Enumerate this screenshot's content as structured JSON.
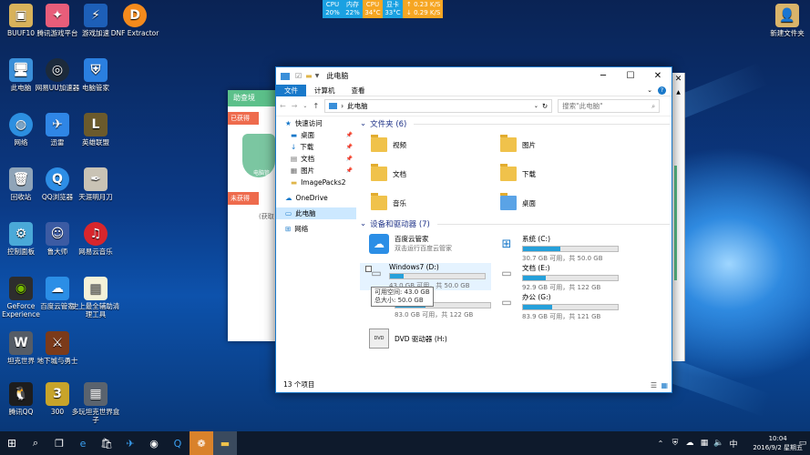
{
  "monitor": {
    "cpu_label": "CPU",
    "cpu_value": "20%",
    "mem_label": "内存",
    "mem_value": "22%",
    "cpu_temp_label": "CPU",
    "cpu_temp": "34°C",
    "gpu_label": "显卡",
    "gpu_temp": "33°C",
    "up": "0.23 K/S",
    "down": "0.29 K/S"
  },
  "desktop_left": [
    [
      "BUUF10",
      "腾讯游戏平台",
      "游戏加速",
      "DNF Extractor"
    ],
    [
      "此电脑",
      "网易UU加速器",
      "电脑管家"
    ],
    [
      "网络",
      "迅雷",
      "英雄联盟"
    ],
    [
      "回收站",
      "QQ浏览器",
      "天涯明月刀"
    ],
    [
      "控制面板",
      "鲁大师",
      "网易云音乐"
    ],
    [
      "GeForce Experience",
      "百度云管家",
      "史上最全辅助清理工具"
    ],
    [
      "坦克世界",
      "地下城与勇士"
    ],
    [
      "腾讯QQ",
      "300",
      "多玩坦克世界盒子"
    ]
  ],
  "desktop_right": "新建文件夹",
  "bgapp": {
    "title": "助查境",
    "tag1": "已获得",
    "tag2": "未获得",
    "text1": "电脑管",
    "text2": "(获取"
  },
  "explorer": {
    "title": "此电脑",
    "tabs": [
      "文件",
      "计算机",
      "查看"
    ],
    "address": "此电脑",
    "search_placeholder": "搜索\"此电脑\"",
    "nav": [
      {
        "label": "快速访问"
      },
      {
        "label": "桌面",
        "pin": "📌"
      },
      {
        "label": "下载",
        "pin": "📌"
      },
      {
        "label": "文档",
        "pin": "📌"
      },
      {
        "label": "图片",
        "pin": "📌"
      },
      {
        "label": "ImagePacks2"
      },
      {
        "label": "OneDrive"
      },
      {
        "label": "此电脑"
      },
      {
        "label": "网络"
      }
    ],
    "folders_header": "文件夹 (6)",
    "folders": [
      "视频",
      "图片",
      "文档",
      "下载",
      "音乐",
      "桌面"
    ],
    "drives_header": "设备和驱动器 (7)",
    "baidu": {
      "name": "百度云管家",
      "sub": "双击运行百度云管家"
    },
    "drives": [
      {
        "name": "系统 (C:)",
        "free": "30.7 GB 可用，共 50.0 GB",
        "fill": 0.39
      },
      {
        "name": "Windows7 (D:)",
        "free": "43.0 GB 可用，共 50.0 GB",
        "fill": 0.14
      },
      {
        "name": "文档 (E:)",
        "free": "92.9 GB 可用，共 122 GB",
        "fill": 0.24
      },
      {
        "name": "",
        "free": "83.0 GB 可用，共 122 GB",
        "fill": 0.32
      },
      {
        "name": "办公 (G:)",
        "free": "83.9 GB 可用，共 121 GB",
        "fill": 0.31
      }
    ],
    "dvd": "DVD 驱动器 (H:)",
    "dvd_badge": "DVD",
    "tooltip": {
      "line1": "可用空间: 43.0 GB",
      "line2": "总大小: 50.0 GB"
    },
    "status": "13 个项目"
  },
  "clock": {
    "time": "10:04",
    "date": "2016/9/2 星期五"
  },
  "colors": {
    "accent": "#1979ca",
    "bar": "#26a0da",
    "folder": "#f0c24b"
  }
}
